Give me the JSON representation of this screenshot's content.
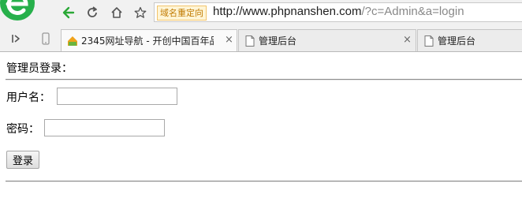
{
  "browser": {
    "address_bar": {
      "badge": "域名重定向",
      "url_domain": "http://www.phpnanshen.com",
      "url_path": "/?c=Admin&a=login"
    },
    "tabs": [
      {
        "title": "2345网址导航 - 开创中国百年品",
        "close": "×"
      },
      {
        "title": "管理后台",
        "close": "×"
      },
      {
        "title": "管理后台"
      }
    ]
  },
  "page": {
    "heading": "管理员登录：",
    "username_label": "用户名：",
    "username_value": "",
    "password_label": "密码：",
    "password_value": "",
    "login_button": "登录"
  },
  "colors": {
    "browser_logo": "#27b04b",
    "back_arrow": "#2aa836",
    "badge_border": "#f2c46a"
  },
  "icons": [
    "browser-logo-icon",
    "back-arrow-icon",
    "refresh-icon",
    "home-icon",
    "star-icon",
    "sidebar-toggle-icon",
    "phone-icon",
    "site-favicon-icon",
    "page-icon"
  ]
}
